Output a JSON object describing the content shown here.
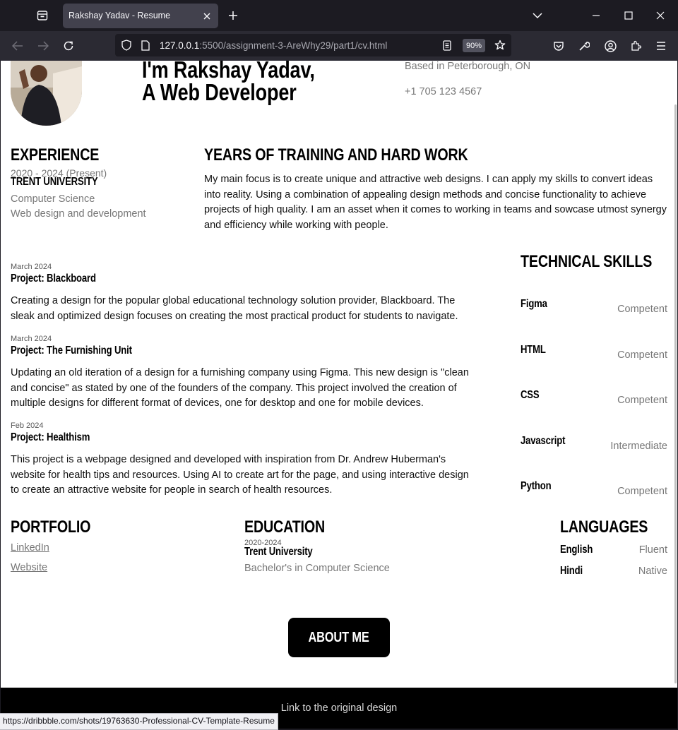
{
  "browser": {
    "tab_title": "Rakshay Yadav - Resume",
    "url_host": "127.0.0.1",
    "url_path": ":5500/assignment-3-AreWhy29/part1/cv.html",
    "zoom": "90%",
    "status_url": "https://dribbble.com/shots/19763630-Professional-CV-Template-Resume"
  },
  "header": {
    "name_line": "I'm Rakshay Yadav,",
    "role_line": "A Web Developer",
    "location": "Based in Peterborough, ON",
    "phone": "+1 705 123 4567"
  },
  "experience": {
    "heading": "EXPERIENCE",
    "dates": "2020 - 2024 (Present)",
    "school": "TRENT UNIVERSITY",
    "field": "Computer Science",
    "focus": "Web design and development"
  },
  "training": {
    "heading": "YEARS OF TRAINING AND HARD WORK",
    "text": "My main focus is to create unique and attractive web designs. I can apply my skills to convert ideas into reality. Using a combination of appealing design methods and concise functionality to achieve projects of high quality. I am an asset when it comes to working in teams and sowcase utmost synergy and efficiency while working with people."
  },
  "projects": [
    {
      "date": "March 2024",
      "title": "Project: Blackboard",
      "text": "Creating a design for the popular global educational technology solution provider, Blackboard. The sleak and optimized design focuses on creating the most practical product for students to navigate."
    },
    {
      "date": "March 2024",
      "title": "Project: The Furnishing Unit",
      "text": "Updating an old iteration of a design for a furnishing company using Figma. This new design is \"clean and concise\" as stated by one of the founders of the company. This project involved the creation of multiple designs for different format of devices, one for desktop and one for mobile devices."
    },
    {
      "date": "Feb 2024",
      "title": "Project: Healthism",
      "text": "This project is a webpage designed and developed with inspiration from Dr. Andrew Huberman's website for health tips and resources. Using AI to create art for the page, and using interactive design to create an attractive website for people in search of health resources."
    }
  ],
  "skills": {
    "heading": "TECHNICAL SKILLS",
    "items": [
      {
        "name": "Figma",
        "level": "Competent"
      },
      {
        "name": "HTML",
        "level": "Competent"
      },
      {
        "name": "CSS",
        "level": "Competent"
      },
      {
        "name": "Javascript",
        "level": "Intermediate"
      },
      {
        "name": "Python",
        "level": "Competent"
      }
    ]
  },
  "portfolio": {
    "heading": "PORTFOLIO",
    "links": [
      "LinkedIn",
      "Website"
    ]
  },
  "education": {
    "heading": "EDUCATION",
    "dates": "2020-2024",
    "school": "Trent University",
    "degree": "Bachelor's in Computer Science"
  },
  "languages": {
    "heading": "LANGUAGES",
    "items": [
      {
        "name": "English",
        "level": "Fluent"
      },
      {
        "name": "Hindi",
        "level": "Native"
      }
    ]
  },
  "about_button": "ABOUT ME",
  "footer_link": "Link to the original design"
}
